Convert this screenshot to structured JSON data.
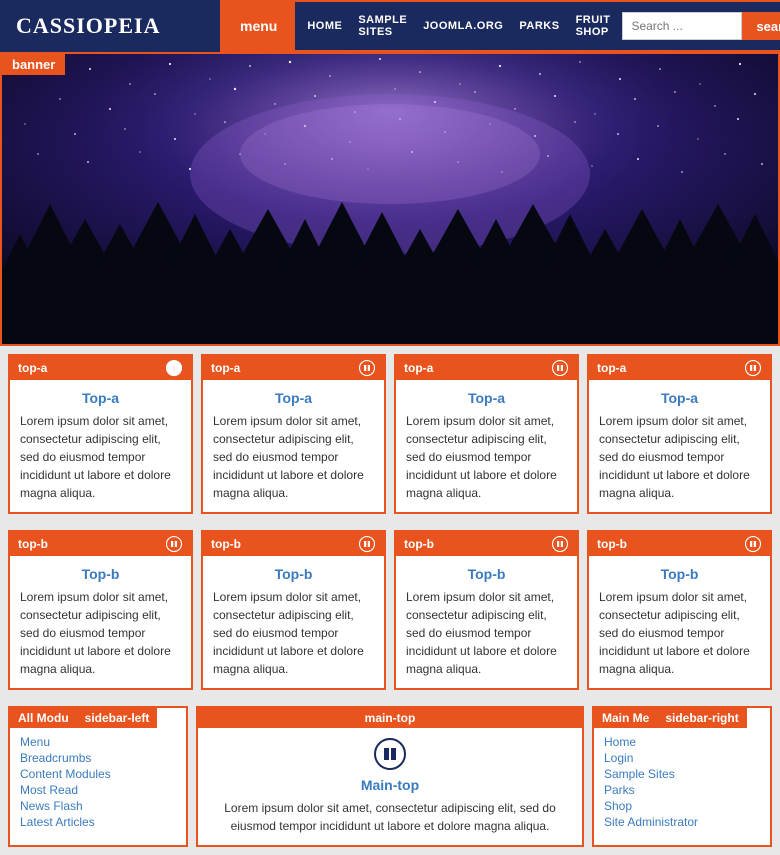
{
  "header": {
    "logo": "CASSIOPEIA",
    "menu_btn": "menu",
    "search_btn": "search",
    "search_placeholder": "Search ...",
    "nav_links": [
      "HOME",
      "SAMPLE SITES",
      "JOOMLA.ORG",
      "PARKS",
      "FRUIT SHOP"
    ]
  },
  "banner": {
    "label": "banner"
  },
  "top_a_row": {
    "label": "top-a",
    "cards": [
      {
        "title": "Top-a",
        "body": "Lorem ipsum dolor sit amet, consectetur adipiscing elit, sed do eiusmod tempor incididunt ut labore et dolore magna aliqua."
      },
      {
        "title": "Top-a",
        "body": "Lorem ipsum dolor sit amet, consectetur adipiscing elit, sed do eiusmod tempor incididunt ut labore et dolore magna aliqua."
      },
      {
        "title": "Top-a",
        "body": "Lorem ipsum dolor sit amet, consectetur adipiscing elit, sed do eiusmod tempor incididunt ut labore et dolore magna aliqua."
      },
      {
        "title": "Top-a",
        "body": "Lorem ipsum dolor sit amet, consectetur adipiscing elit, sed do eiusmod tempor incididunt ut labore et dolore magna aliqua."
      }
    ]
  },
  "top_b_row": {
    "label": "top-b",
    "cards": [
      {
        "title": "Top-b",
        "body": "Lorem ipsum dolor sit amet, consectetur adipiscing elit, sed do eiusmod tempor incididunt ut labore et dolore magna aliqua."
      },
      {
        "title": "Top-b",
        "body": "Lorem ipsum dolor sit amet, consectetur adipiscing elit, sed do eiusmod tempor incididunt ut labore et dolore magna aliqua."
      },
      {
        "title": "Top-b",
        "body": "Lorem ipsum dolor sit amet, consectetur adipiscing elit, sed do eiusmod tempor incididunt ut labore et dolore magna aliqua."
      },
      {
        "title": "Top-b",
        "body": "Lorem ipsum dolor sit amet, consectetur adipiscing elit, sed do eiusmod tempor incididunt ut labore et dolore magna aliqua."
      }
    ]
  },
  "bottom": {
    "sidebar_left": {
      "label": "All Modu",
      "label2": "sidebar-left",
      "links": [
        "Menu",
        "Breadcrumbs",
        "Content Modules",
        "Most Read",
        "News Flash",
        "Latest Articles"
      ]
    },
    "main_top": {
      "label": "main-top",
      "title": "Main-top",
      "body": "Lorem ipsum dolor sit amet, consectetur adipiscing elit, sed do eiusmod tempor incididunt ut labore et dolore magna aliqua."
    },
    "sidebar_right": {
      "label": "Main Me",
      "label2": "sidebar-right",
      "links": [
        "Home",
        "Login",
        "Sample Sites",
        "Parks",
        "Shop",
        "Site Administrator"
      ]
    }
  }
}
